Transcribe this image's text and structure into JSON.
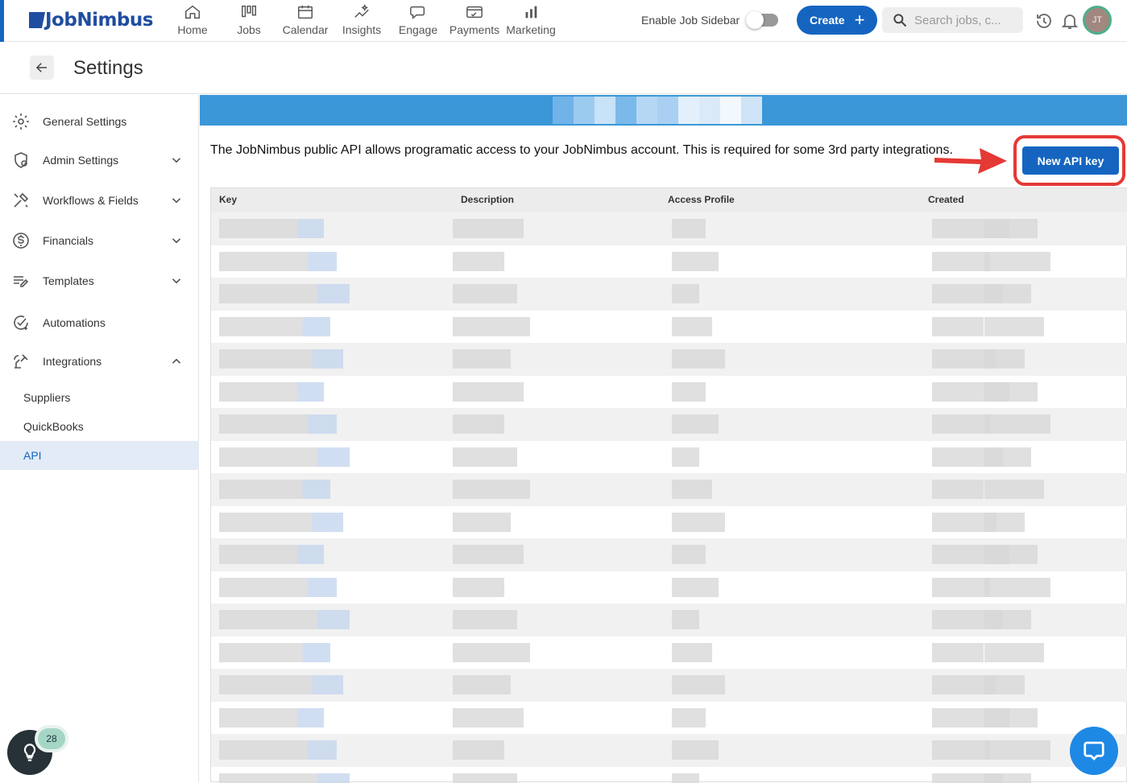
{
  "app": {
    "brand": "JobNimbus"
  },
  "nav": [
    {
      "label": "Home",
      "icon": "home-icon"
    },
    {
      "label": "Jobs",
      "icon": "jobs-icon"
    },
    {
      "label": "Calendar",
      "icon": "calendar-icon"
    },
    {
      "label": "Insights",
      "icon": "insights-icon"
    },
    {
      "label": "Engage",
      "icon": "engage-icon"
    },
    {
      "label": "Payments",
      "icon": "payments-icon"
    },
    {
      "label": "Marketing",
      "icon": "marketing-icon"
    }
  ],
  "header": {
    "sidebar_toggle_label": "Enable Job Sidebar",
    "sidebar_toggle_on": false,
    "create_label": "Create",
    "search_placeholder": "Search jobs, c...",
    "avatar_initials": "JT"
  },
  "page": {
    "title": "Settings"
  },
  "sidebar": {
    "items": [
      {
        "label": "General Settings",
        "icon": "gear-icon",
        "expandable": false
      },
      {
        "label": "Admin Settings",
        "icon": "admin-shield-icon",
        "expandable": true,
        "expanded": false
      },
      {
        "label": "Workflows & Fields",
        "icon": "tools-icon",
        "expandable": true,
        "expanded": false
      },
      {
        "label": "Financials",
        "icon": "dollar-icon",
        "expandable": true,
        "expanded": false
      },
      {
        "label": "Templates",
        "icon": "template-icon",
        "expandable": true,
        "expanded": false
      },
      {
        "label": "Automations",
        "icon": "automation-icon",
        "expandable": false
      },
      {
        "label": "Integrations",
        "icon": "integrations-icon",
        "expandable": true,
        "expanded": true
      }
    ],
    "subitems": [
      {
        "label": "Suppliers",
        "active": false
      },
      {
        "label": "QuickBooks",
        "active": false
      },
      {
        "label": "API",
        "active": true
      }
    ]
  },
  "main": {
    "description": "The JobNimbus public API allows programatic access to your JobNimbus account. This is required for some 3rd party integrations.",
    "new_key_label": "New API key",
    "table": {
      "columns": [
        "Key",
        "Description",
        "Access Profile",
        "Created"
      ],
      "row_count": 18
    }
  },
  "floating": {
    "help_badge": "28"
  },
  "colors": {
    "accent": "#1565c0",
    "banner": "#3b97d8",
    "highlight": "#e53935"
  }
}
